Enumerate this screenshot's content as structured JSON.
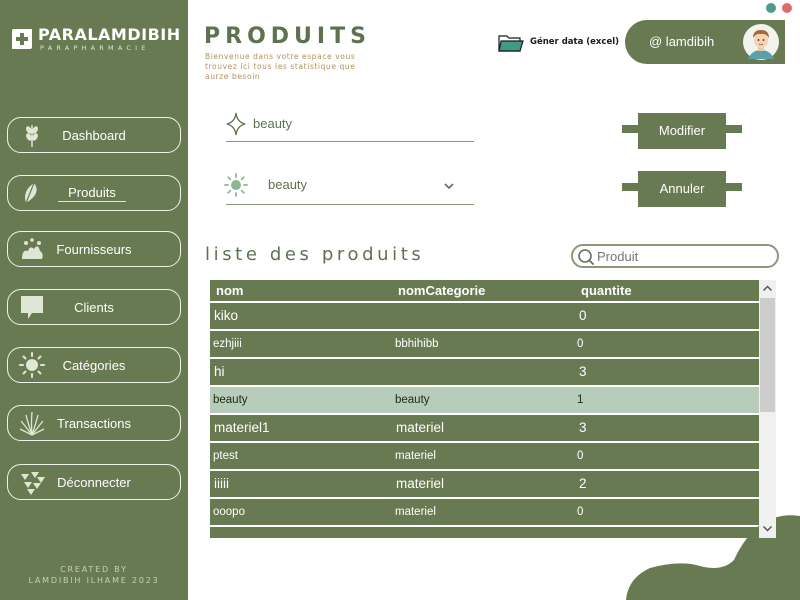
{
  "brand": {
    "name": "PARALAMDIBIH",
    "tagline": "PARAPHARMACIE"
  },
  "sidebar": {
    "items": [
      {
        "label": "Dashboard",
        "icon": "wheat-icon"
      },
      {
        "label": "Produits",
        "icon": "leaf-icon",
        "active": true
      },
      {
        "label": "Fournisseurs",
        "icon": "splash-icon"
      },
      {
        "label": "Clients",
        "icon": "chat-bubble-icon"
      },
      {
        "label": "Catégories",
        "icon": "sun-icon"
      },
      {
        "label": "Transactions",
        "icon": "plant-icon"
      },
      {
        "label": "Déconnecter",
        "icon": "triangles-icon"
      }
    ],
    "credit_line1": "CREATED BY",
    "credit_line2": "LAMDIBIH ILHAME 2023"
  },
  "header": {
    "title": "PRODUITS",
    "subtitle": "Bienvenue dans votre espace vous trouvez ici tous les statistique que aurze besoin",
    "export_label": "Géner data (excel)",
    "user": "@ lamdibih"
  },
  "form": {
    "name_value": "beauty",
    "category_value": "beauty",
    "modify_label": "Modifier",
    "cancel_label": "Annuler"
  },
  "list": {
    "title": "liste des produits",
    "search_placeholder": "Produit"
  },
  "table": {
    "columns": [
      "nom",
      "nomCategorie",
      "quantite"
    ],
    "rows": [
      {
        "nom": "kiko",
        "nomCategorie": "",
        "quantite": "0"
      },
      {
        "nom": "ezhjiii",
        "nomCategorie": "bbhihibb",
        "quantite": "0"
      },
      {
        "nom": "hi",
        "nomCategorie": "",
        "quantite": "3"
      },
      {
        "nom": "beauty",
        "nomCategorie": "beauty",
        "quantite": "1",
        "selected": true
      },
      {
        "nom": "materiel1",
        "nomCategorie": "materiel",
        "quantite": "3"
      },
      {
        "nom": "ptest",
        "nomCategorie": "materiel",
        "quantite": "0"
      },
      {
        "nom": "iiiii",
        "nomCategorie": "materiel",
        "quantite": "2"
      },
      {
        "nom": "ooopo",
        "nomCategorie": "materiel",
        "quantite": "0"
      },
      {
        "nom": "",
        "nomCategorie": "",
        "quantite": ""
      }
    ]
  },
  "colors": {
    "primary": "#687a52",
    "selected_row": "#b7ccb9",
    "accent_text": "#b3905a",
    "window_dot_teal": "#4f9a8a",
    "window_dot_red": "#e06b6b"
  }
}
